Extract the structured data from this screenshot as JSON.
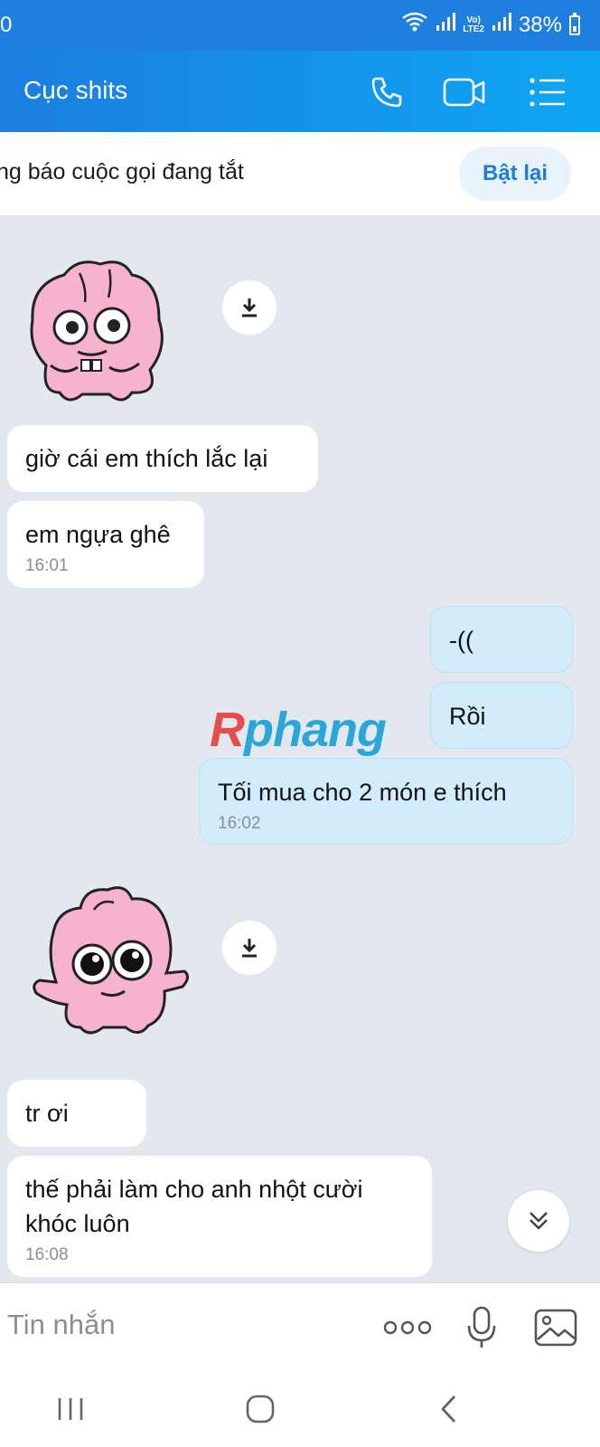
{
  "status_bar": {
    "time": "0",
    "network": "VoLTE LTE2",
    "battery": "38%"
  },
  "header": {
    "title": "Cục shits",
    "icons": [
      "phone-icon",
      "video-call-icon",
      "menu-list-icon"
    ]
  },
  "notice": {
    "text": "ng báo cuộc gọi đang tắt",
    "button_label": "Bật lại"
  },
  "messages": [
    {
      "type": "sticker",
      "sender": "other",
      "icon": "pink-bunny-sticker"
    },
    {
      "type": "text",
      "sender": "other",
      "text": "giờ cái em thích lắc lại"
    },
    {
      "type": "text",
      "sender": "other",
      "text": "em ngựa ghê",
      "time": "16:01"
    },
    {
      "type": "text",
      "sender": "me",
      "text": "-(("
    },
    {
      "type": "text",
      "sender": "me",
      "text": "Rồi"
    },
    {
      "type": "text",
      "sender": "me",
      "text": "Tối mua cho 2 món e thích",
      "time": "16:02"
    },
    {
      "type": "sticker",
      "sender": "other",
      "icon": "pink-bunny-sticker"
    },
    {
      "type": "text",
      "sender": "other",
      "text": "tr ơi"
    },
    {
      "type": "text",
      "sender": "other",
      "text": "thế phải làm cho anh nhột cười khóc luôn",
      "time": "16:08"
    }
  ],
  "watermark": {
    "first": "R",
    "rest": "phang"
  },
  "input": {
    "placeholder": "Tin nhắn",
    "icons": [
      "more-options-icon",
      "microphone-icon",
      "image-icon"
    ]
  },
  "nav": {
    "icons": [
      "recent-apps-icon",
      "home-icon",
      "back-icon"
    ]
  },
  "colors": {
    "header_start": "#1b7ee0",
    "header_end": "#0ea6f2",
    "chat_bg": "#e2e8ee",
    "outgoing_bubble": "#d3ecfc",
    "incoming_bubble": "#ffffff",
    "accent": "#1f7ad9"
  }
}
